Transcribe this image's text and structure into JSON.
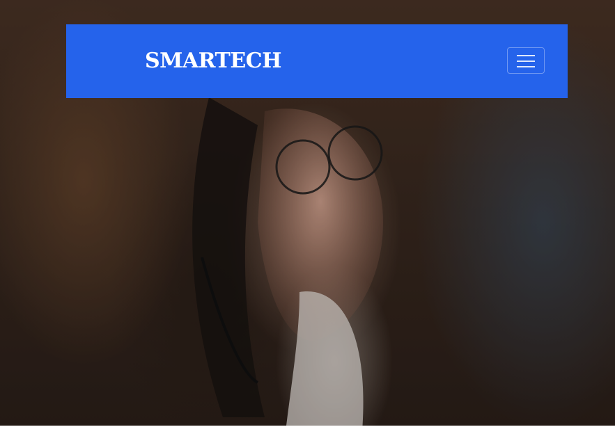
{
  "navbar": {
    "brand": "SMARTECH",
    "toggle_icon": "hamburger-menu-icon",
    "background_color": "#2563eb"
  },
  "hero": {
    "image": "woman-with-glasses-photo"
  }
}
